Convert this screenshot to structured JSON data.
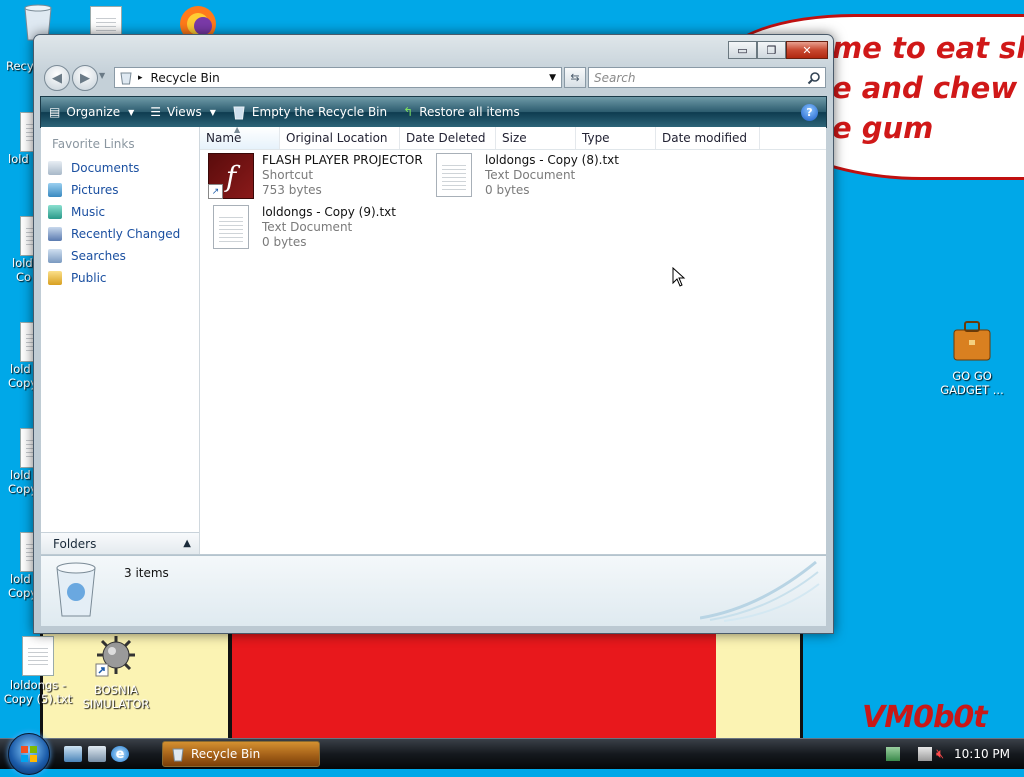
{
  "wallpaper": {
    "speech_text": "me to eat shit\ne and chew\ne gum",
    "signature": "VM0b0t",
    "colors": {
      "sky": "#00a8e8",
      "red": "#e8181c",
      "cheese": "#fbf3b3"
    }
  },
  "desktop_icons": {
    "recycle_label": "Recy",
    "left_partial_1": "lold",
    "left_partial_2a": "lold",
    "left_partial_2b": "Co",
    "left_partial_3a": "lold",
    "left_partial_3b": "Copy",
    "left_partial_4a": "lold",
    "left_partial_4b": "Copy",
    "left_partial_5a": "lold",
    "left_partial_5b": "Copy",
    "loldongs5_line1": "loldongs -",
    "loldongs5_line2": "Copy (5).txt",
    "bosnia_line1": "BOSNIA",
    "bosnia_line2": "SIMULATOR",
    "gadget_line1": "GO GO",
    "gadget_line2": "GADGET ..."
  },
  "window": {
    "title": "Recycle Bin",
    "controls": {
      "minimize": "▭",
      "maximize": "❐",
      "close": "✕"
    },
    "address": {
      "breadcrumb_sep": "▸",
      "location": "Recycle Bin"
    },
    "search_placeholder": "Search",
    "commands": {
      "organize": "Organize",
      "views": "Views",
      "empty": "Empty the Recycle Bin",
      "restore": "Restore all items",
      "help": "?"
    },
    "nav_pane": {
      "header": "Favorite Links",
      "links": [
        "Documents",
        "Pictures",
        "Music",
        "Recently Changed",
        "Searches",
        "Public"
      ],
      "folders_label": "Folders"
    },
    "columns": [
      "Name",
      "Original Location",
      "Date Deleted",
      "Size",
      "Type",
      "Date modified"
    ],
    "items": [
      {
        "name": "FLASH PLAYER PROJECTOR",
        "type": "Shortcut",
        "size": "753 bytes",
        "icon": "flash-shortcut-icon"
      },
      {
        "name": "loldongs - Copy (8).txt",
        "type": "Text Document",
        "size": "0 bytes",
        "icon": "text-document-icon"
      },
      {
        "name": "loldongs - Copy (9).txt",
        "type": "Text Document",
        "size": "0 bytes",
        "icon": "text-document-icon"
      }
    ],
    "details": {
      "count": "3 items"
    }
  },
  "taskbar": {
    "task_label": "Recycle Bin",
    "clock": "10:10 PM"
  }
}
